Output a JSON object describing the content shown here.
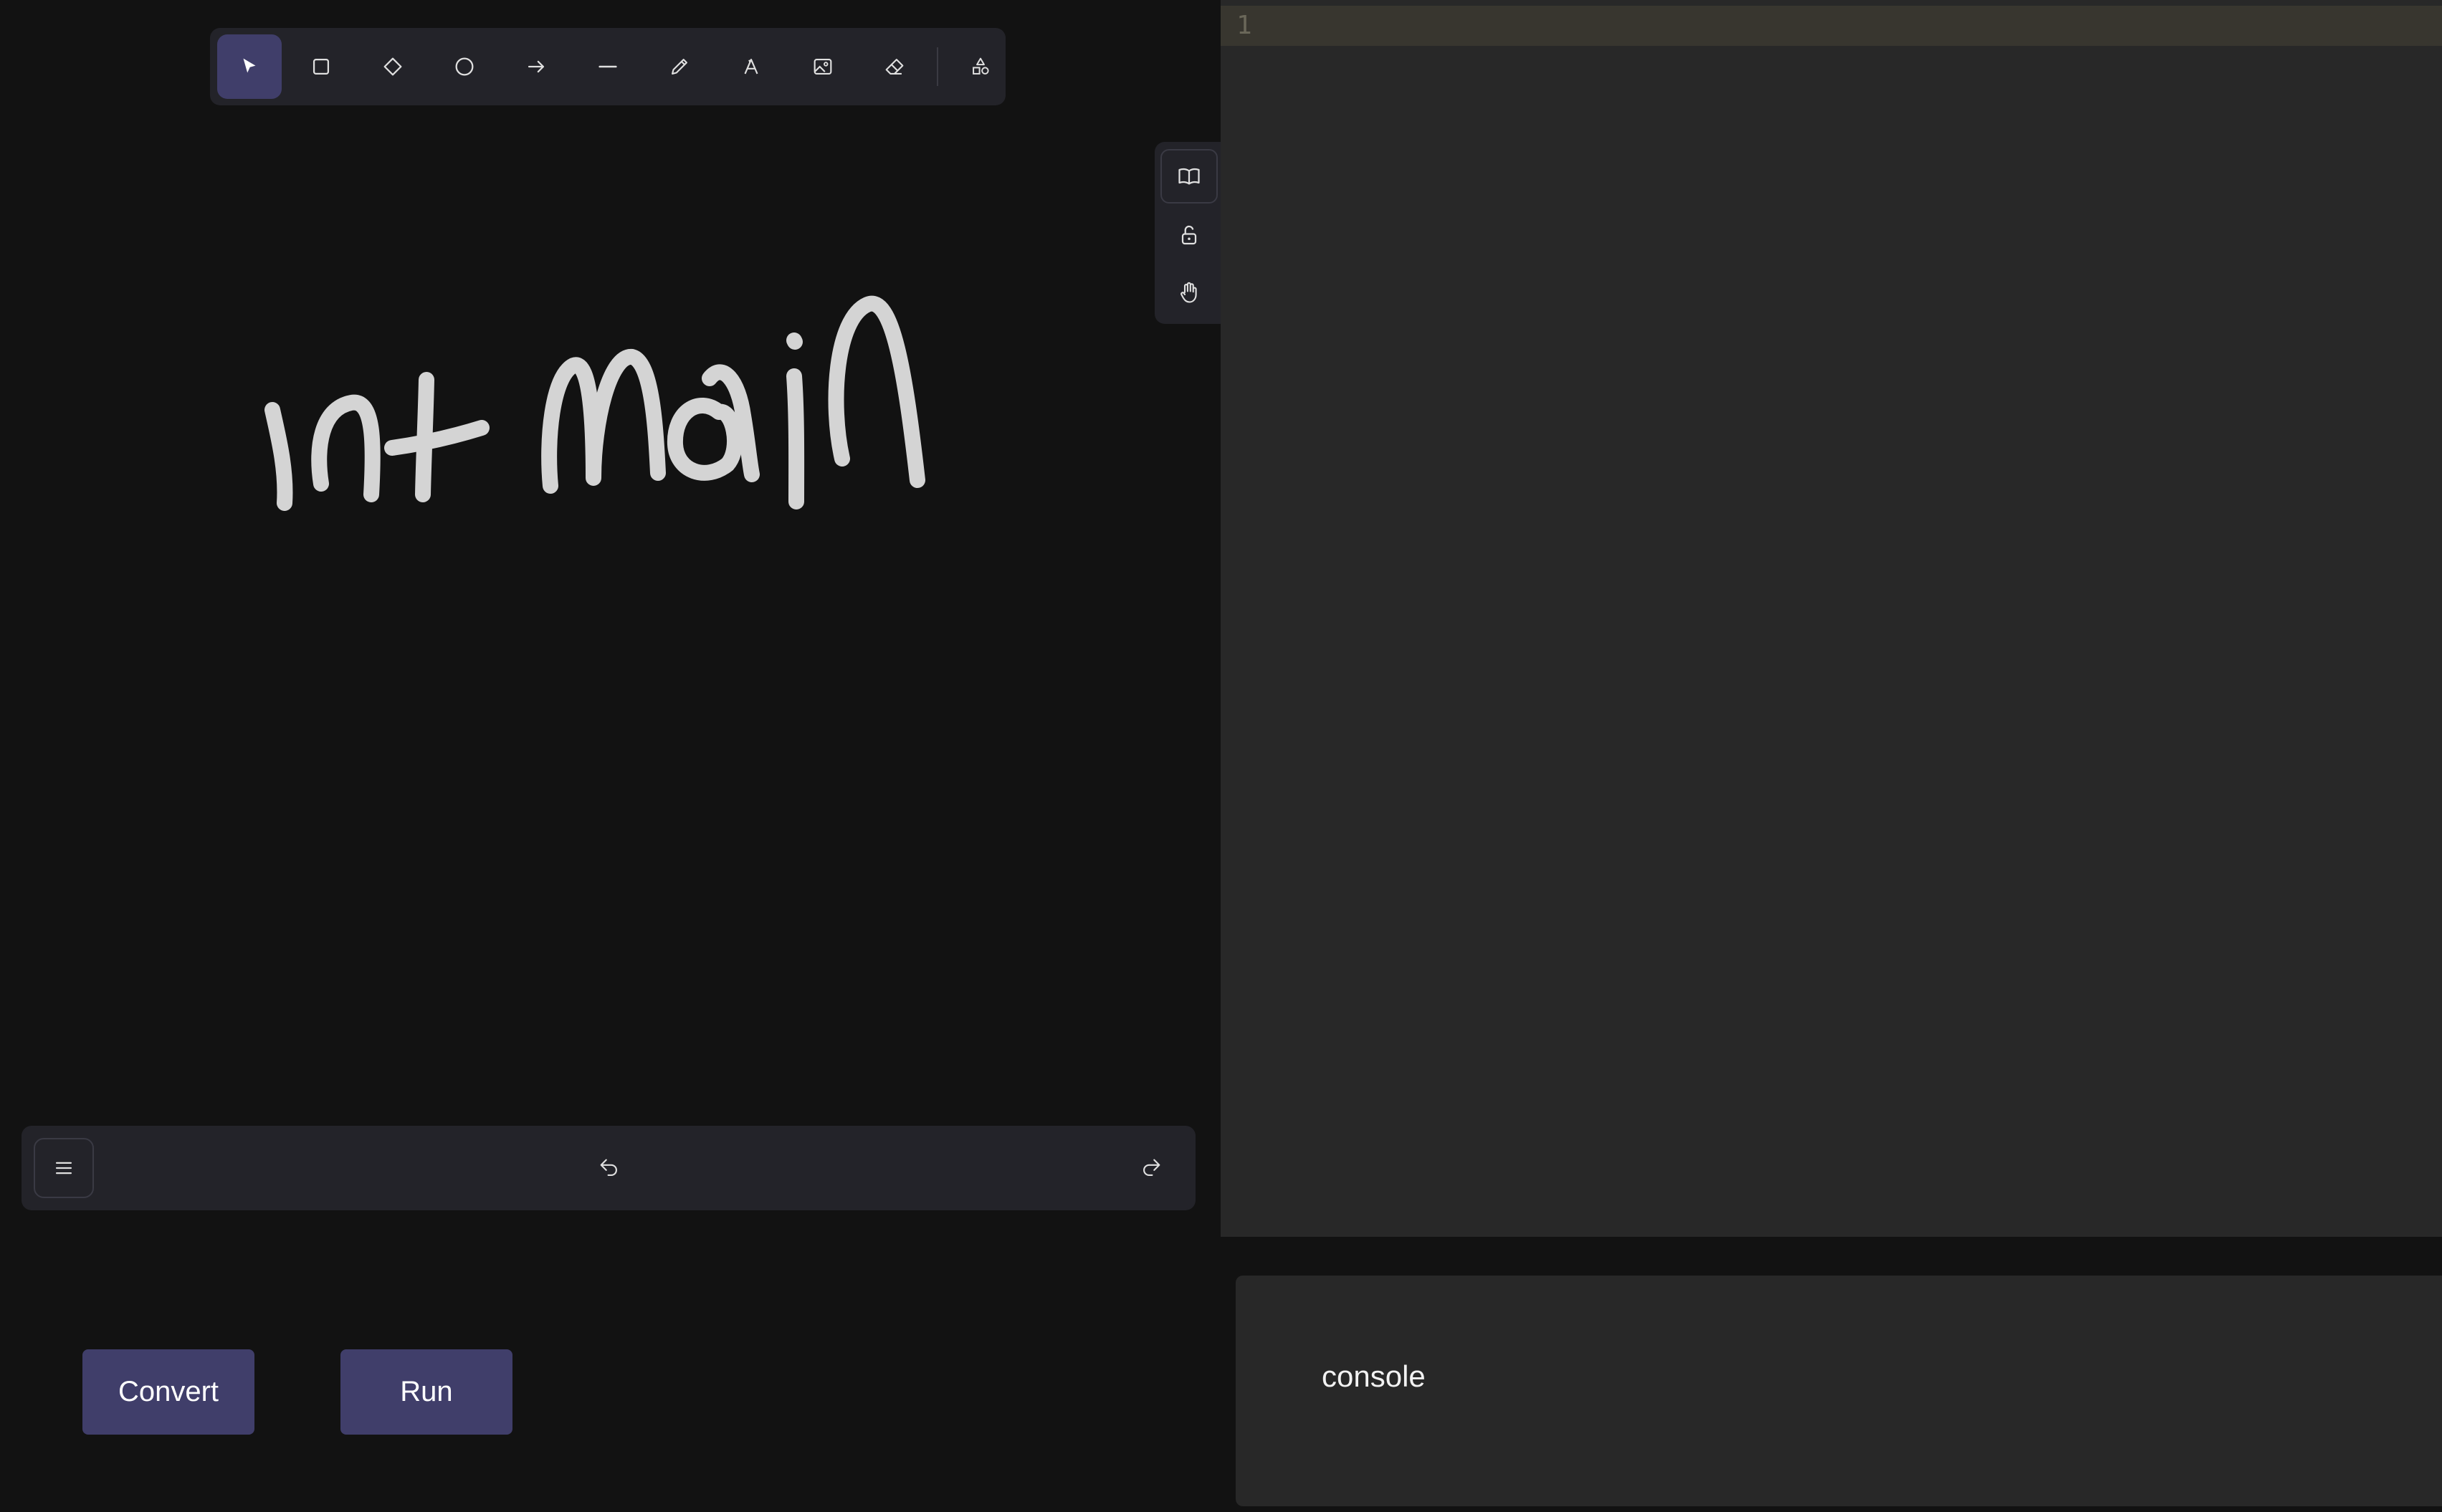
{
  "toolbar": {
    "tools": [
      {
        "name": "selection",
        "icon": "cursor-icon",
        "active": true
      },
      {
        "name": "rectangle",
        "icon": "rectangle-icon"
      },
      {
        "name": "diamond",
        "icon": "diamond-icon"
      },
      {
        "name": "ellipse",
        "icon": "ellipse-icon"
      },
      {
        "name": "arrow",
        "icon": "arrow-icon"
      },
      {
        "name": "line",
        "icon": "line-icon"
      },
      {
        "name": "draw",
        "icon": "pencil-icon"
      },
      {
        "name": "text",
        "icon": "text-icon"
      },
      {
        "name": "image",
        "icon": "image-icon"
      },
      {
        "name": "eraser",
        "icon": "eraser-icon"
      },
      {
        "name": "more-shapes",
        "icon": "shapes-icon"
      }
    ]
  },
  "side_tools": [
    {
      "name": "library",
      "icon": "book-icon"
    },
    {
      "name": "lock",
      "icon": "unlock-icon"
    },
    {
      "name": "hand",
      "icon": "hand-icon"
    }
  ],
  "canvas": {
    "stroke_color": "#d4d4d4"
  },
  "bottom_bar": {
    "menu_icon": "hamburger-icon",
    "undo_icon": "undo-icon",
    "redo_icon": "redo-icon"
  },
  "actions": {
    "convert_label": "Convert",
    "run_label": "Run"
  },
  "editor": {
    "line_numbers": [
      "1"
    ],
    "content": ""
  },
  "console": {
    "label": "console"
  },
  "colors": {
    "background": "#121212",
    "panel": "#232329",
    "accent": "#403e6a",
    "editor_bg": "#282828",
    "active_line": "#38362f"
  }
}
